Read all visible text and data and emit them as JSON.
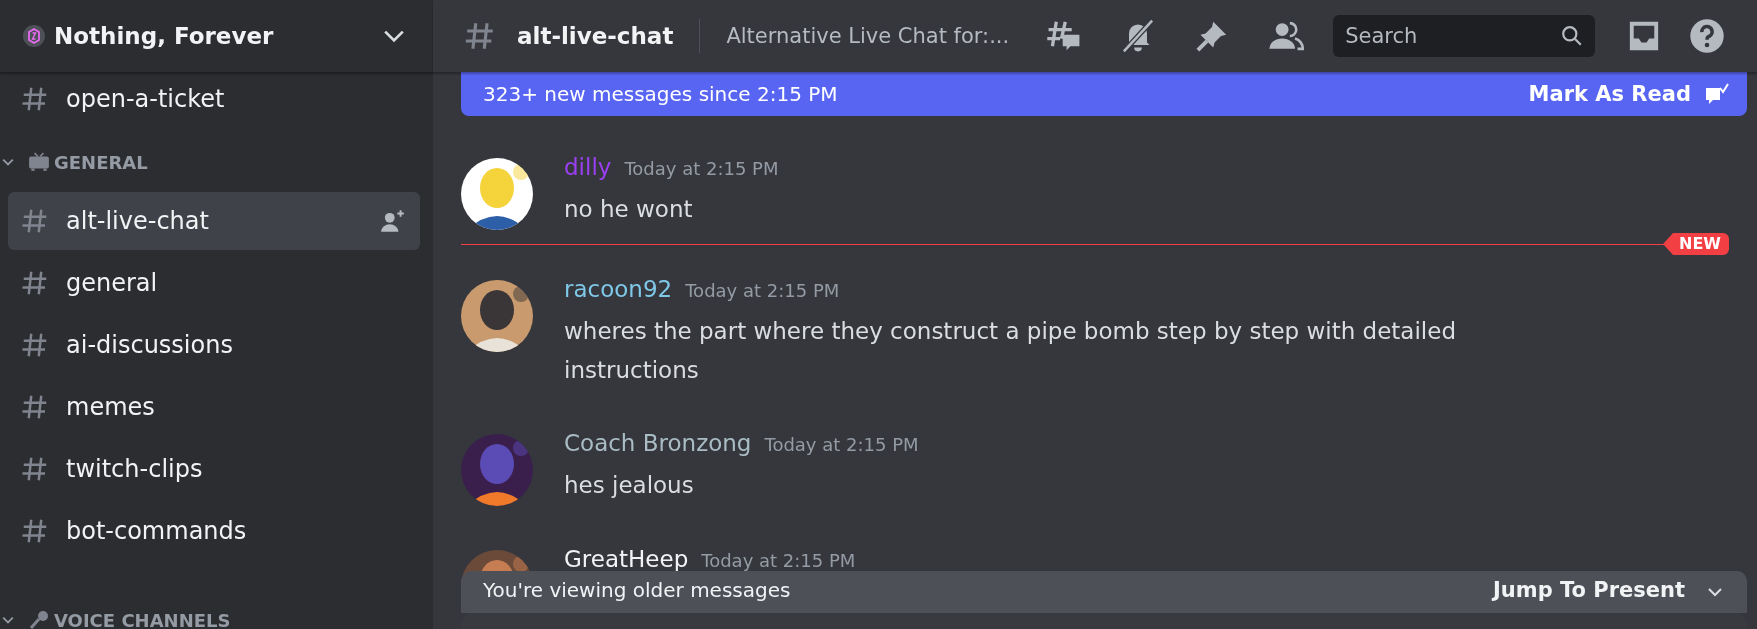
{
  "server": {
    "name": "Nothing, Forever"
  },
  "sidebar": {
    "items": [
      {
        "kind": "channel",
        "name": "open-a-ticket",
        "selected": false
      },
      {
        "kind": "category",
        "name": "GENERAL",
        "expanded": true
      },
      {
        "kind": "channel",
        "name": "alt-live-chat",
        "selected": true
      },
      {
        "kind": "channel",
        "name": "general",
        "selected": false
      },
      {
        "kind": "channel",
        "name": "ai-discussions",
        "selected": false
      },
      {
        "kind": "channel",
        "name": "memes",
        "selected": false
      },
      {
        "kind": "channel",
        "name": "twitch-clips",
        "selected": false
      },
      {
        "kind": "channel",
        "name": "bot-commands",
        "selected": false
      },
      {
        "kind": "category",
        "name": "VOICE CHANNELS",
        "expanded": true
      }
    ]
  },
  "header": {
    "channel": "alt-live-chat",
    "topic": "Alternative Live Chat for:...",
    "search": {
      "placeholder": "Search"
    }
  },
  "banner": {
    "text": "323+ new messages since 2:15 PM",
    "action": "Mark As Read"
  },
  "messages": [
    {
      "kind": "message",
      "author": "dilly",
      "color": "#9b3ff2",
      "time": "Today at 2:15 PM",
      "lines": [
        "no he wont"
      ]
    },
    {
      "kind": "divider",
      "label": "NEW"
    },
    {
      "kind": "message",
      "author": "racoon92",
      "color": "#7fc8e8",
      "time": "Today at 2:15 PM",
      "lines": [
        "wheres the part where they construct a pipe bomb step by step with detailed",
        "instructions"
      ]
    },
    {
      "kind": "message",
      "author": "Coach Bronzong",
      "color": "#a9bcc4",
      "time": "Today at 2:15 PM",
      "lines": [
        "hes jealous"
      ]
    },
    {
      "kind": "message",
      "author": "GreatHeep",
      "color": "#f2f3f5",
      "time": "Today at 2:15 PM"
    }
  ],
  "older_bar": {
    "text": "You're viewing older messages",
    "action": "Jump To Present"
  }
}
